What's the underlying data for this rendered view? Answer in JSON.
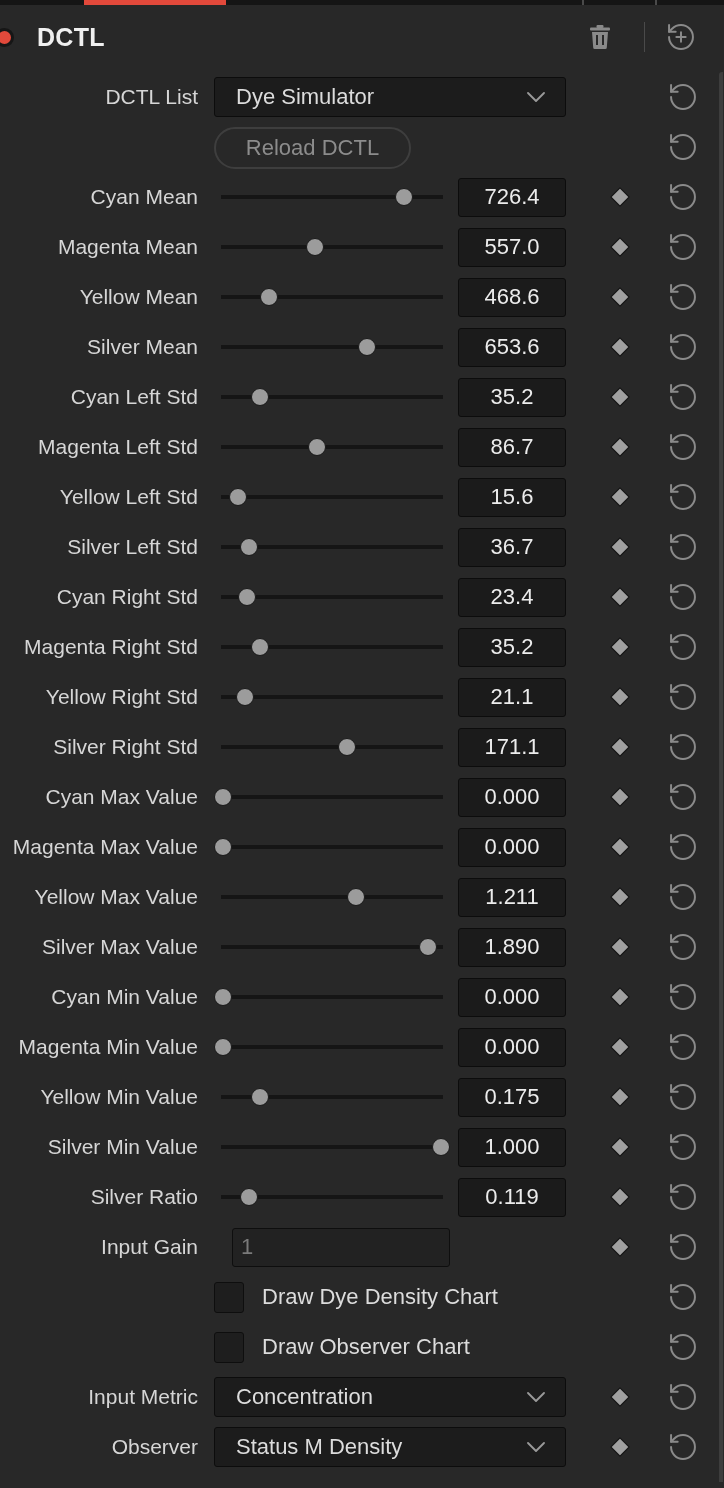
{
  "tab_strip": [
    {
      "selected": true
    },
    {
      "selected": false
    },
    {
      "selected": false
    }
  ],
  "header": {
    "title": "DCTL",
    "enabled": true
  },
  "controls": [
    {
      "kind": "dropdown",
      "label": "DCTL List",
      "value": "Dye Simulator",
      "keyframe": false
    },
    {
      "kind": "button",
      "label": "Reload DCTL",
      "disabled": true,
      "keyframe": false
    },
    {
      "kind": "slider",
      "label": "Cyan Mean",
      "value": "726.4",
      "level": 0.83,
      "keyframe": true
    },
    {
      "kind": "slider",
      "label": "Magenta Mean",
      "value": "557.0",
      "level": 0.42,
      "keyframe": true
    },
    {
      "kind": "slider",
      "label": "Yellow Mean",
      "value": "468.6",
      "level": 0.21,
      "keyframe": true
    },
    {
      "kind": "slider",
      "label": "Silver Mean",
      "value": "653.6",
      "level": 0.66,
      "keyframe": true
    },
    {
      "kind": "slider",
      "label": "Cyan Left Std",
      "value": "35.2",
      "level": 0.17,
      "keyframe": true
    },
    {
      "kind": "slider",
      "label": "Magenta Left Std",
      "value": "86.7",
      "level": 0.43,
      "keyframe": true
    },
    {
      "kind": "slider",
      "label": "Yellow Left Std",
      "value": "15.6",
      "level": 0.07,
      "keyframe": true
    },
    {
      "kind": "slider",
      "label": "Silver Left Std",
      "value": "36.7",
      "level": 0.12,
      "keyframe": true
    },
    {
      "kind": "slider",
      "label": "Cyan Right Std",
      "value": "23.4",
      "level": 0.11,
      "keyframe": true
    },
    {
      "kind": "slider",
      "label": "Magenta Right Std",
      "value": "35.2",
      "level": 0.17,
      "keyframe": true
    },
    {
      "kind": "slider",
      "label": "Yellow Right Std",
      "value": "21.1",
      "level": 0.1,
      "keyframe": true
    },
    {
      "kind": "slider",
      "label": "Silver Right Std",
      "value": "171.1",
      "level": 0.57,
      "keyframe": true
    },
    {
      "kind": "slider",
      "label": "Cyan Max Value",
      "value": "0.000",
      "level": 0,
      "keyframe": true
    },
    {
      "kind": "slider",
      "label": "Magenta Max Value",
      "value": "0.000",
      "level": 0,
      "keyframe": true
    },
    {
      "kind": "slider",
      "label": "Yellow Max Value",
      "value": "1.211",
      "level": 0.61,
      "keyframe": true
    },
    {
      "kind": "slider",
      "label": "Silver Max Value",
      "value": "1.890",
      "level": 0.94,
      "keyframe": true
    },
    {
      "kind": "slider",
      "label": "Cyan Min Value",
      "value": "0.000",
      "level": 0,
      "keyframe": true
    },
    {
      "kind": "slider",
      "label": "Magenta Min Value",
      "value": "0.000",
      "level": 0,
      "keyframe": true
    },
    {
      "kind": "slider",
      "label": "Yellow Min Value",
      "value": "0.175",
      "level": 0.17,
      "keyframe": true
    },
    {
      "kind": "slider",
      "label": "Silver Min Value",
      "value": "1.000",
      "level": 1,
      "keyframe": true
    },
    {
      "kind": "slider",
      "label": "Silver Ratio",
      "value": "0.119",
      "level": 0.12,
      "keyframe": true
    },
    {
      "kind": "number",
      "label": "Input Gain",
      "value": "1",
      "disabled": true,
      "keyframe": true
    },
    {
      "kind": "checkbox",
      "label": "Draw Dye Density Chart",
      "checked": false,
      "keyframe": false
    },
    {
      "kind": "checkbox",
      "label": "Draw Observer Chart",
      "checked": false,
      "keyframe": false
    },
    {
      "kind": "dropdown",
      "label": "Input Metric",
      "value": "Concentration",
      "keyframe": true
    },
    {
      "kind": "dropdown",
      "label": "Observer",
      "value": "Status M Density",
      "keyframe": true
    }
  ]
}
